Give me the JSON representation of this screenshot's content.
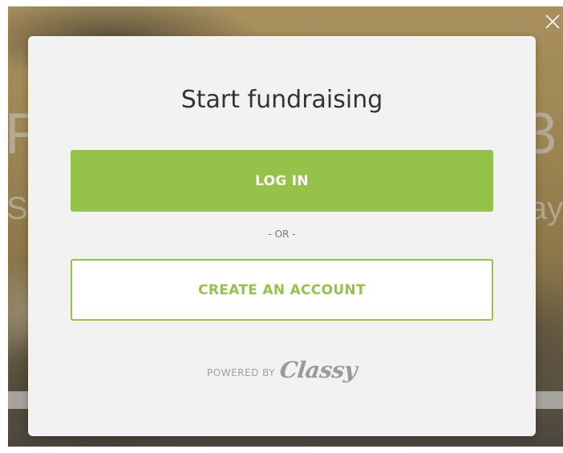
{
  "background": {
    "heading_left": "F",
    "heading_right": "3",
    "sub_left": "Se",
    "sub_right": "ay"
  },
  "modal": {
    "title": "Start fundraising",
    "login_label": "LOG IN",
    "separator": "- OR -",
    "create_label": "CREATE AN ACCOUNT",
    "powered_by": "POWERED BY",
    "brand_logo": "Classy"
  },
  "icons": {
    "close": "close-icon"
  },
  "colors": {
    "accent_green": "#95c249",
    "modal_bg": "#f2f2f2",
    "title_text": "#333333",
    "muted_text": "#777777"
  }
}
